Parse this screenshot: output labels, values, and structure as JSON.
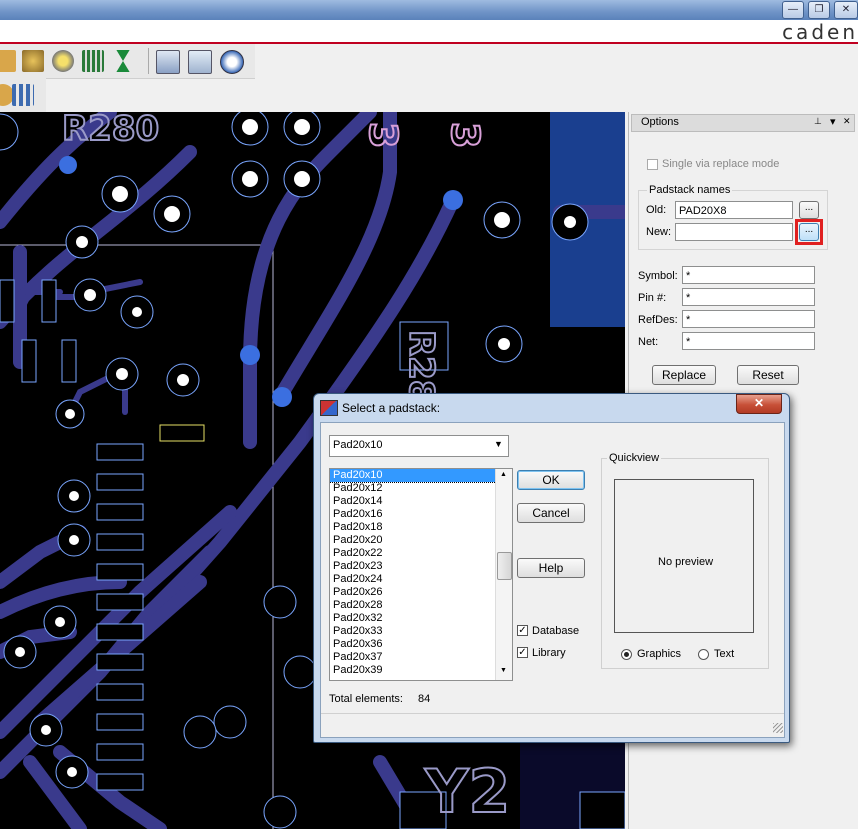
{
  "brand": "caden",
  "window_buttons": [
    "—",
    "❐",
    "✕"
  ],
  "options": {
    "title": "Options",
    "pin": "⊥",
    "dropdown": "▾",
    "close": "✕",
    "single_via_replace_label": "Single via replace mode",
    "padstack_names_label": "Padstack names",
    "old_label": "Old:",
    "old_value": "PAD20X8",
    "new_label": "New:",
    "new_value": "",
    "browse_label": "...",
    "symbol_label": "Symbol:",
    "symbol_value": "*",
    "pin_label": "Pin #:",
    "pin_value": "*",
    "refdes_label": "RefDes:",
    "refdes_value": "*",
    "net_label": "Net:",
    "net_value": "*",
    "replace_button": "Replace",
    "reset_button": "Reset"
  },
  "dialog": {
    "title": "Select a padstack:",
    "close": "✕",
    "combo_value": "Pad20x10",
    "list_items": [
      "Pad20x10",
      "Pad20x12",
      "Pad20x14",
      "Pad20x16",
      "Pad20x18",
      "Pad20x20",
      "Pad20x22",
      "Pad20x23",
      "Pad20x24",
      "Pad20x26",
      "Pad20x28",
      "Pad20x32",
      "Pad20x33",
      "Pad20x36",
      "Pad20x37",
      "Pad20x39"
    ],
    "ok": "OK",
    "cancel": "Cancel",
    "help": "Help",
    "database_label": "Database",
    "library_label": "Library",
    "quickview_label": "Quickview",
    "no_preview": "No preview",
    "graphics_label": "Graphics",
    "text_label": "Text",
    "total_label": "Total elements:",
    "total_value": "84"
  },
  "canvas": {
    "refdes_labels": [
      "R280",
      "R28",
      "Y2",
      "3",
      "3"
    ]
  },
  "colors": {
    "trace": "#3a3a8c",
    "via": "#3b6fe0",
    "pad_outline": "#7aa6ff",
    "highlight": "#e02020",
    "selection": "#3399ff"
  }
}
